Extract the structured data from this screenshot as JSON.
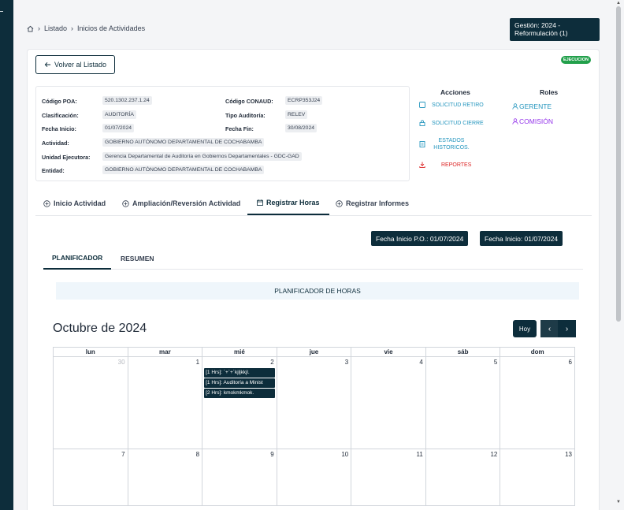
{
  "breadcrumb": {
    "items": [
      "Listado",
      "Inicios de Actividades"
    ]
  },
  "gestion": {
    "line1": "Gestión: 2024 -",
    "line2": "Reformulación (1)"
  },
  "status_badge": "EJECUCION",
  "back_button": "Volver al Listado",
  "info": {
    "codigo_poa_label": "Código POA:",
    "codigo_poa": "520.1302.237.1.24",
    "codigo_conaud_label": "Código CONAUD:",
    "codigo_conaud": "ECRP353J24",
    "clasificacion_label": "Clasificación:",
    "clasificacion": "AUDITORÍA",
    "tipo_auditoria_label": "Tipo Auditoría:",
    "tipo_auditoria": "RELEV",
    "fecha_inicio_label": "Fecha Inicio:",
    "fecha_inicio": "01/07/2024",
    "fecha_fin_label": "Fecha Fin:",
    "fecha_fin": "30/08/2024",
    "actividad_label": "Actividad:",
    "actividad": "GOBIERNO AUTÓNOMO DEPARTAMENTAL DE COCHABAMBA",
    "unidad_label": "Unidad Ejecutora:",
    "unidad": "Gerencia Departamental de Auditoría en Gobiernos Departamentales - GDC-GAD",
    "entidad_label": "Entidad:",
    "entidad": "GOBIERNO AUTÓNOMO DEPARTAMENTAL DE COCHABAMBA"
  },
  "acciones": {
    "title": "Acciones",
    "solicitud_retiro": "SOLICITUD RETIRO",
    "solicitud_cierre": "SOLICITUD CIERRE",
    "estados_1": "ESTADOS",
    "estados_2": "HISTORICOS.",
    "reportes": "REPORTES"
  },
  "roles": {
    "title": "Roles",
    "gerente": "GERENTE",
    "comision": "COMISIÓN"
  },
  "tabs": [
    "Inicio Actividad",
    "Ampliación/Reversión Actividad",
    "Registrar Horas",
    "Registrar Informes"
  ],
  "pills": {
    "fecha_po": "Fecha Inicio P.O.: 01/07/2024",
    "fecha_inicio": "Fecha Inicio: 01/07/2024"
  },
  "subtabs": [
    "PLANIFICADOR",
    "RESUMEN"
  ],
  "planner_banner": "PLANIFICADOR DE HORAS",
  "calendar": {
    "title": "Octubre de 2024",
    "today_label": "Hoy",
    "weekdays": [
      "lun",
      "mar",
      "mié",
      "jue",
      "vie",
      "sáb",
      "dom"
    ],
    "week1": [
      "30",
      "1",
      "2",
      "3",
      "4",
      "5",
      "6"
    ],
    "week2": [
      "7",
      "8",
      "9",
      "10",
      "11",
      "12",
      "13"
    ],
    "events": [
      "[1 Hrs]: ´+´+´kjljkkjl.",
      "[1 Hrs]: Auditoría a Minist",
      "[2 Hrs]: kmokmkmok."
    ]
  },
  "colors": {
    "primary": "#0d2d3b",
    "accent": "#2596be",
    "danger": "#dc2626",
    "badge": "#22a04b",
    "role": "#9333ea"
  }
}
